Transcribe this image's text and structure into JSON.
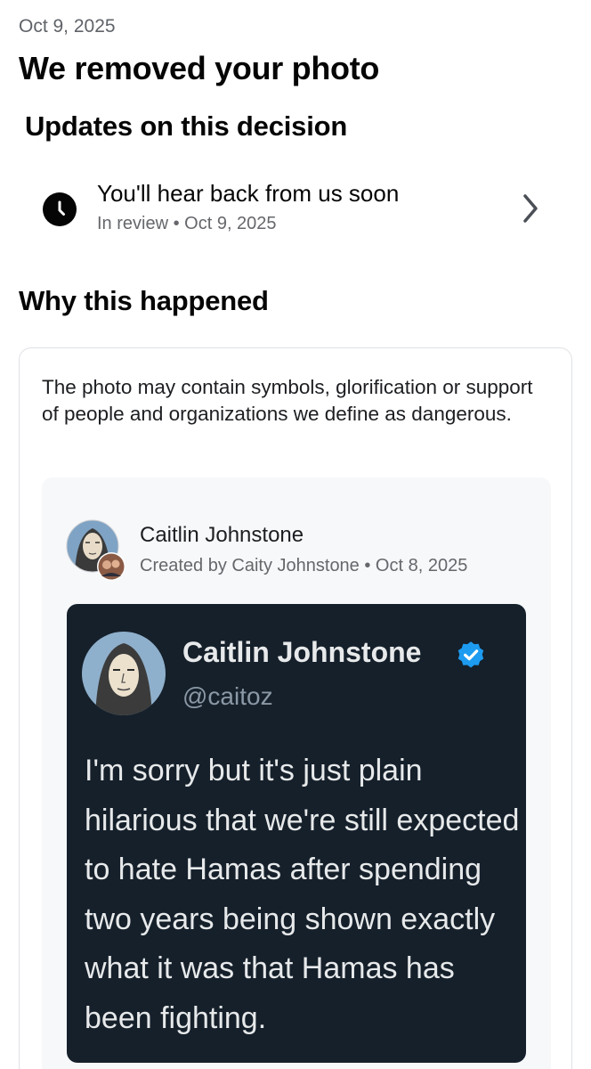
{
  "header": {
    "date": "Oct 9, 2025",
    "title": "We removed your photo"
  },
  "updates": {
    "heading": "Updates on this decision",
    "item": {
      "icon": "clock-icon",
      "title": "You'll hear back from us soon",
      "status": "In review",
      "date": "Oct 9, 2025",
      "meta": "In review • Oct 9, 2025"
    }
  },
  "why": {
    "heading": "Why this happened",
    "description": "The photo may contain symbols, glorification or support of people and organizations we define as dangerous."
  },
  "post": {
    "author": "Caitlin Johnstone",
    "meta": "Created by Caity Johnstone • Oct 8, 2025",
    "tweet": {
      "name": "Caitlin Johnstone",
      "handle": "@caitoz",
      "verified_color": "#1d9bf0",
      "text": "I'm sorry but it's just plain hilarious that we're still expected to hate Hamas after spending two years being shown exactly what it was that Hamas has been fighting."
    }
  },
  "colors": {
    "tweet_background": "#15202b",
    "secondary_text": "#65676b"
  }
}
